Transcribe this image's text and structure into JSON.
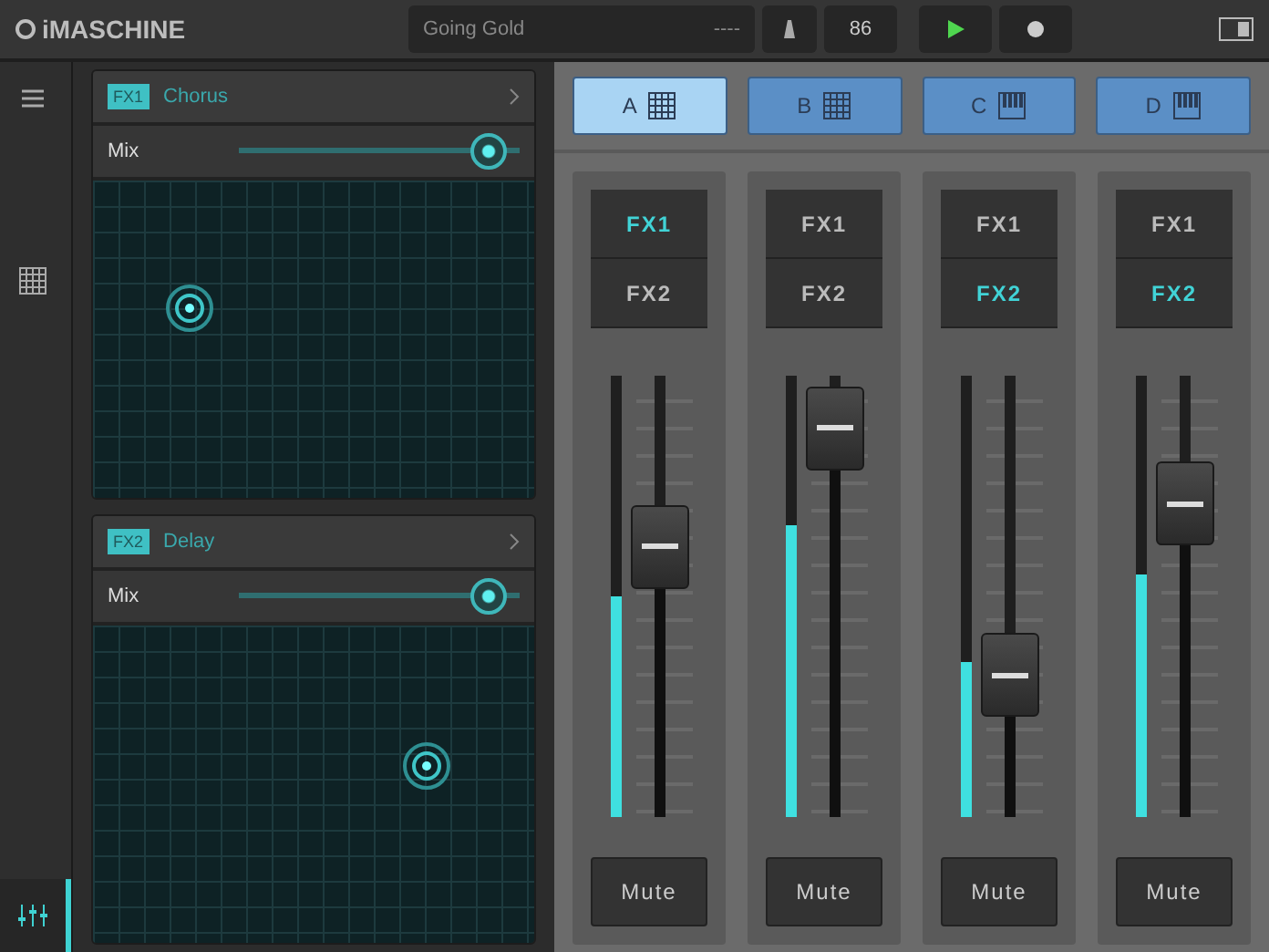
{
  "app": {
    "title": "iMASCHINE"
  },
  "transport": {
    "project": "Going Gold",
    "position": "----",
    "tempo": "86",
    "playing": true
  },
  "sidebar": [
    {
      "kind": "menu",
      "selected": false
    },
    {
      "kind": "pads",
      "selected": false
    },
    {
      "kind": "mixer",
      "selected": true
    }
  ],
  "effects": [
    {
      "slot": "FX1",
      "name": "Chorus",
      "mix_label": "Mix",
      "mix": {
        "level": 0.95
      }
    },
    {
      "slot": "FX2",
      "name": "Delay",
      "mix_label": "Mix",
      "mix": {
        "level": 0.95
      }
    }
  ],
  "groups": [
    {
      "label": "A",
      "kind": "pads",
      "selected": true
    },
    {
      "label": "B",
      "kind": "pads",
      "selected": false
    },
    {
      "label": "C",
      "kind": "keys",
      "selected": false
    },
    {
      "label": "D",
      "kind": "keys",
      "selected": false
    }
  ],
  "channels": [
    {
      "sends": [
        {
          "label": "FX1",
          "on": true
        },
        {
          "label": "FX2",
          "on": false
        }
      ],
      "meter": {
        "level": 0.5
      },
      "fader": {
        "level": 0.64
      },
      "mute": "Mute"
    },
    {
      "sends": [
        {
          "label": "FX1",
          "on": false
        },
        {
          "label": "FX2",
          "on": false
        }
      ],
      "meter": {
        "level": 0.66
      },
      "fader": {
        "level": 0.97
      },
      "mute": "Mute"
    },
    {
      "sends": [
        {
          "label": "FX1",
          "on": false
        },
        {
          "label": "FX2",
          "on": true
        }
      ],
      "meter": {
        "level": 0.35
      },
      "fader": {
        "level": 0.28
      },
      "mute": "Mute"
    },
    {
      "sends": [
        {
          "label": "FX1",
          "on": false
        },
        {
          "label": "FX2",
          "on": true
        }
      ],
      "meter": {
        "level": 0.55
      },
      "fader": {
        "level": 0.76
      },
      "mute": "Mute"
    }
  ]
}
